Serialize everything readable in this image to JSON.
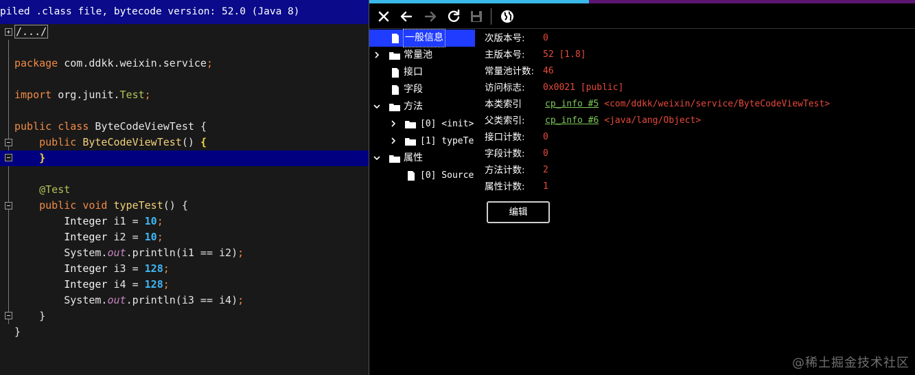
{
  "editor": {
    "banner": "piled .class file, bytecode version: 52.0 (Java 8)",
    "collapsed_header": "/.../",
    "package_line": {
      "kw": "package",
      "name": "com.ddkk.weixin.service",
      "semi": ";"
    },
    "import_line": {
      "kw": "import",
      "pkg": "org.junit.",
      "cls": "Test",
      "semi": ";"
    },
    "class_line": {
      "kw1": "public",
      "kw2": "class",
      "name": "ByteCodeViewTest",
      "brace": "{"
    },
    "ctor_line": {
      "kw": "public",
      "name": "ByteCodeViewTest",
      "parens": "()",
      "brace": "{"
    },
    "ctor_close": "}",
    "annotation": "@Test",
    "method_line": {
      "kw1": "public",
      "kw2": "void",
      "name": "typeTest",
      "rest": "() {"
    },
    "stmt1": {
      "type": "Integer",
      "rest": " i1 = ",
      "num": "10",
      "semi": ";"
    },
    "stmt2": {
      "type": "Integer",
      "rest": " i2 = ",
      "num": "10",
      "semi": ";"
    },
    "stmt3": {
      "pre": "System.",
      "field": "out",
      "post": ".println(i1 == i2)",
      "semi": ";"
    },
    "stmt4": {
      "type": "Integer",
      "rest": " i3 = ",
      "num": "128",
      "semi": ";"
    },
    "stmt5": {
      "type": "Integer",
      "rest": " i4 = ",
      "num": "128",
      "semi": ";"
    },
    "stmt6": {
      "pre": "System.",
      "field": "out",
      "post": ".println(i3 == i4)",
      "semi": ";"
    },
    "method_close": "}",
    "class_close": "}"
  },
  "toolbar": {
    "buttons": [
      "close-icon",
      "back-arrow-icon",
      "forward-arrow-icon",
      "refresh-icon",
      "save-icon",
      "globe-icon"
    ]
  },
  "tree": {
    "general_info": "一般信息",
    "constant_pool": "常量池",
    "interfaces": "接口",
    "fields": "字段",
    "methods": "方法",
    "method_0": "[0] <init>",
    "method_1": "[1] typeTe",
    "attributes": "属性",
    "attr_0": "[0] Source"
  },
  "info": {
    "minor_label": "次版本号:",
    "minor_value": "0",
    "major_label": "主版本号:",
    "major_value": "52 [1.8]",
    "cp_count_label": "常量池计数:",
    "cp_count_value": "46",
    "access_label": "访问标志:",
    "access_value": "0x0021 [public]",
    "this_label": "本类索引",
    "this_link": "cp_info #5",
    "this_ref": "<com/ddkk/weixin/service/ByteCodeViewTest>",
    "super_label": "父类索引:",
    "super_link": "cp_info #6",
    "super_ref": "<java/lang/Object>",
    "iface_count_label": "接口计数:",
    "iface_count_value": "0",
    "field_count_label": "字段计数:",
    "field_count_value": "0",
    "method_count_label": "方法计数:",
    "method_count_value": "2",
    "attr_count_label": "属性计数:",
    "attr_count_value": "1",
    "edit_button": "编辑"
  },
  "watermark": "@稀土掘金技术社区",
  "colors": {
    "banner_bg": "#0a0a8a",
    "highlight_line": "#000080",
    "keyword": "#f28c46",
    "number": "#3fb7f5",
    "value_red": "#e84a3a",
    "link_green": "#7fc95a",
    "tree_selected": "#1f3cff"
  }
}
